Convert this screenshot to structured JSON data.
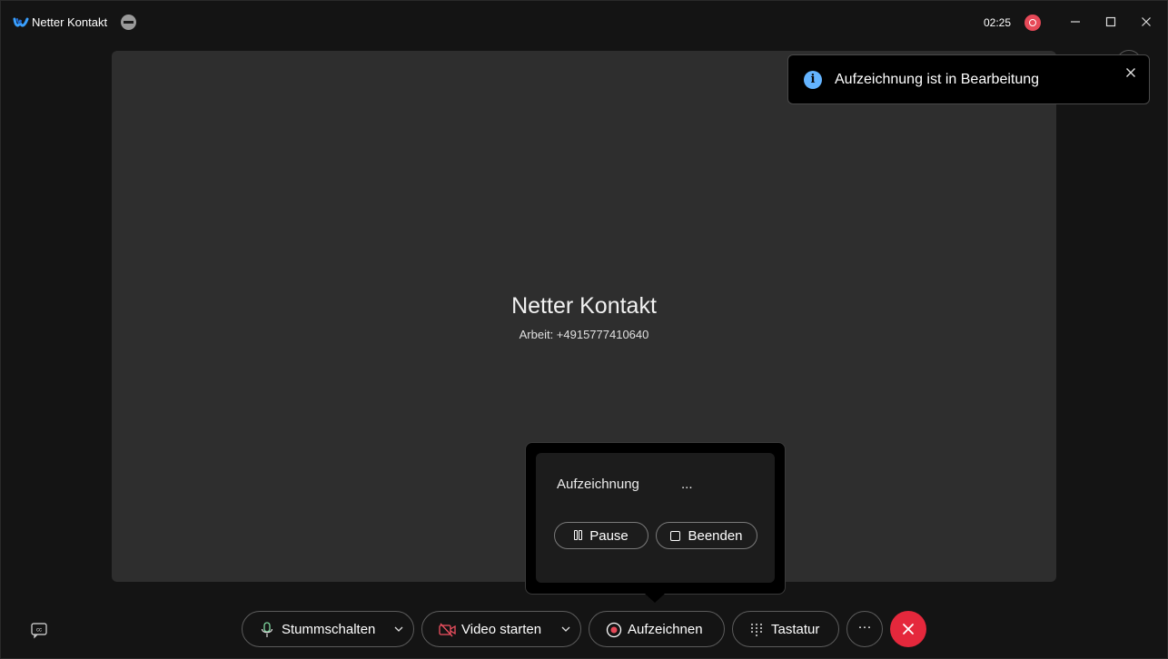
{
  "window": {
    "title": "Netter Kontakt",
    "timer": "02:25",
    "minimize_glyph": "—",
    "maximize_glyph": "☐",
    "close_glyph": "✕"
  },
  "call": {
    "contact_name": "Netter Kontakt",
    "contact_detail": "Arbeit: +4915777410640"
  },
  "toast": {
    "icon": "i",
    "message": "Aufzeichnung ist in Bearbeitung",
    "close_glyph": "✕"
  },
  "recording_popover": {
    "title": "Aufzeichnung",
    "status": "...",
    "pause_label": "Pause",
    "stop_label": "Beenden"
  },
  "toolbar": {
    "mute_label": "Stummschalten",
    "video_label": "Video starten",
    "record_label": "Aufzeichnen",
    "keypad_label": "Tastatur",
    "more_glyph": "···",
    "chevron_glyph": "⌄"
  },
  "colors": {
    "record_red": "#e64958",
    "hangup_red": "#e5283c",
    "info_blue": "#64b4ff",
    "mic_green": "#7fd9a0",
    "video_off_red": "#f05060"
  },
  "icons": [
    "webex-logo-icon",
    "collapse-icon",
    "recording-indicator-icon",
    "info-icon",
    "close-icon",
    "pause-icon",
    "stop-icon",
    "closed-captions-icon",
    "microphone-icon",
    "video-off-icon",
    "record-icon",
    "keypad-icon",
    "more-icon",
    "hangup-icon",
    "chevron-down-icon"
  ]
}
